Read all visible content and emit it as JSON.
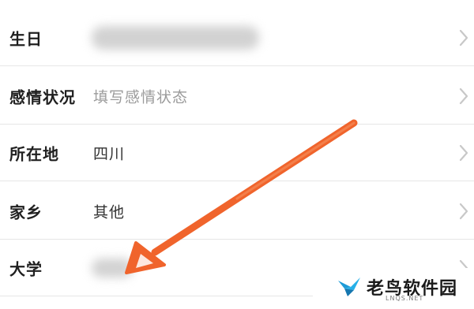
{
  "profile": {
    "rows": [
      {
        "label": "生日",
        "value": "",
        "placeholder": false,
        "blurred": true
      },
      {
        "label": "感情状况",
        "value": "填写感情状态",
        "placeholder": true,
        "blurred": false
      },
      {
        "label": "所在地",
        "value": "四川",
        "placeholder": false,
        "blurred": false
      },
      {
        "label": "家乡",
        "value": "其他",
        "placeholder": false,
        "blurred": false
      },
      {
        "label": "大学",
        "value": "",
        "placeholder": false,
        "blurred": true
      }
    ],
    "chevron_icon": "chevron-right-icon"
  },
  "annotation": {
    "arrow_color": "#f0642c",
    "arrow_target": "大学"
  },
  "watermark": {
    "name": "老鸟软件园",
    "url": "LNQS.NET"
  },
  "colors": {
    "label": "#1f1f1f",
    "placeholder": "#9b9b9b",
    "divider": "#e6e6e6",
    "chevron": "#c8c8c8"
  }
}
